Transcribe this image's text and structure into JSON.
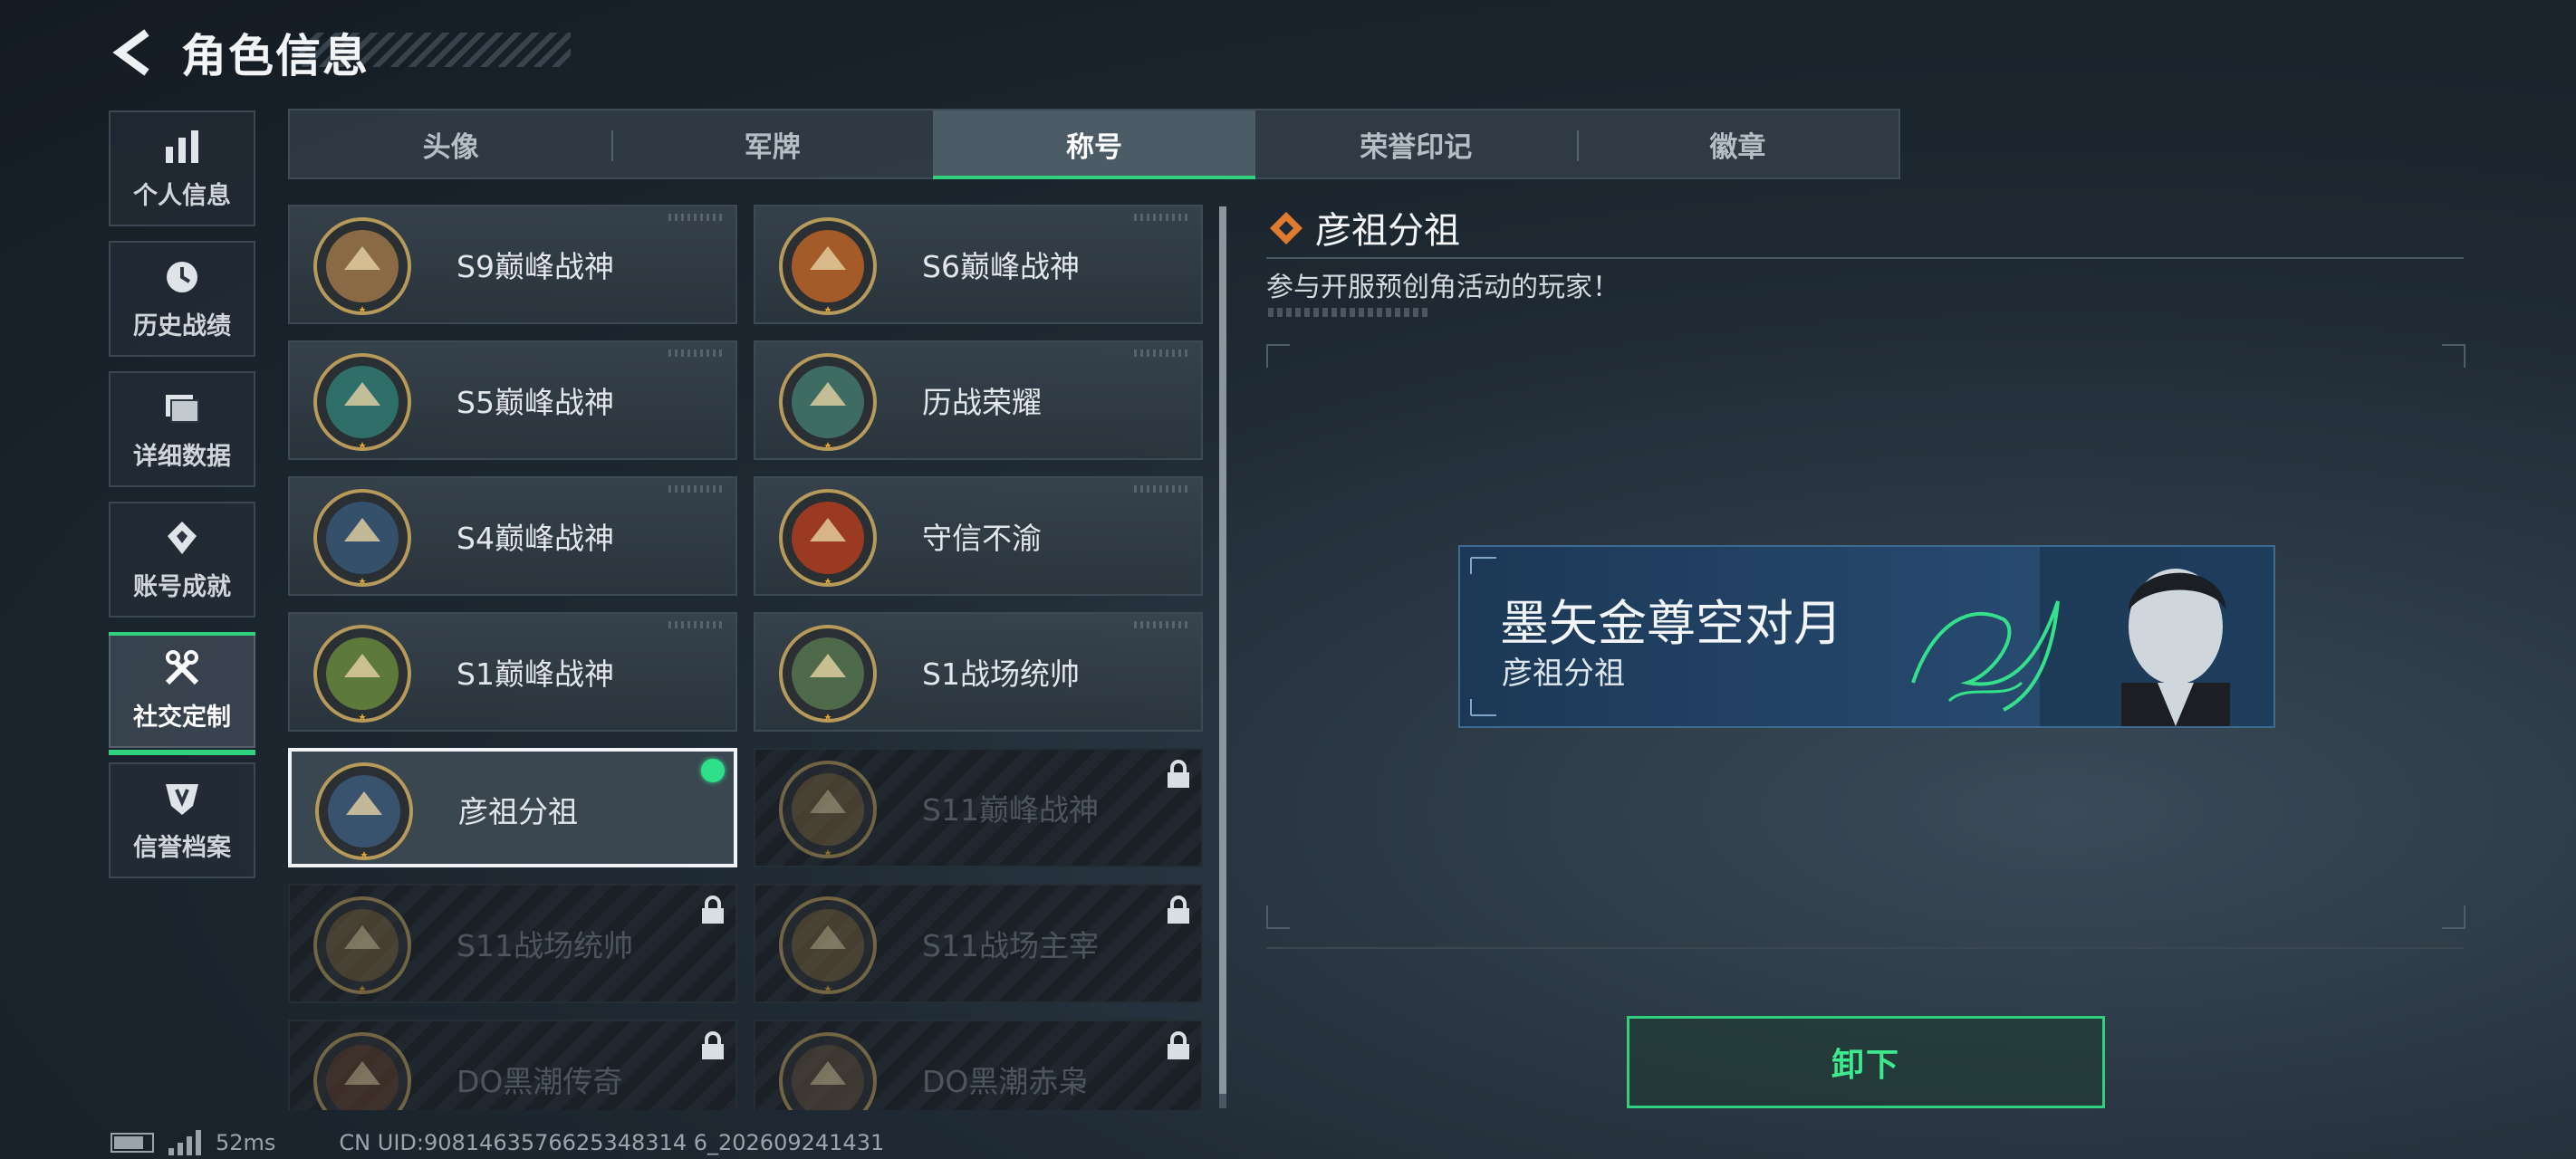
{
  "header": {
    "title": "角色信息"
  },
  "sidebar": {
    "items": [
      {
        "label": "个人信息",
        "icon": "bar-chart-icon"
      },
      {
        "label": "历史战绩",
        "icon": "history-clock-icon"
      },
      {
        "label": "详细数据",
        "icon": "folder-icon"
      },
      {
        "label": "账号成就",
        "icon": "achievement-icon"
      },
      {
        "label": "社交定制",
        "icon": "tools-icon",
        "active": true
      },
      {
        "label": "信誉档案",
        "icon": "credit-shield-icon"
      }
    ]
  },
  "tabs": [
    {
      "label": "头像"
    },
    {
      "label": "军牌"
    },
    {
      "label": "称号",
      "active": true
    },
    {
      "label": "荣誉印记"
    },
    {
      "label": "徽章"
    }
  ],
  "titles": [
    {
      "name": "S9巅峰战神",
      "emblem": "fortress-emblem-icon",
      "locked": false
    },
    {
      "name": "S6巅峰战神",
      "emblem": "t-shield-emblem-icon",
      "locked": false
    },
    {
      "name": "S5巅峰战神",
      "emblem": "diver-skull-emblem-icon",
      "locked": false
    },
    {
      "name": "历战荣耀",
      "emblem": "trophy-emblem-icon",
      "locked": false
    },
    {
      "name": "S4巅峰战神",
      "emblem": "helmet-nvg-emblem-icon",
      "locked": false
    },
    {
      "name": "守信不渝",
      "emblem": "scales-emblem-icon",
      "locked": false
    },
    {
      "name": "S1巅峰战神",
      "emblem": "crocodile-emblem-icon",
      "locked": false
    },
    {
      "name": "S1战场统帅",
      "emblem": "tank-emblem-icon",
      "locked": false
    },
    {
      "name": "彦祖分祖",
      "emblem": "portrait-emblem-icon",
      "locked": false,
      "selected": true
    },
    {
      "name": "S11巅峰战神",
      "emblem": "vehicle-emblem-icon",
      "locked": true
    },
    {
      "name": "S11战场统帅",
      "emblem": "apc-emblem-icon",
      "locked": true
    },
    {
      "name": "S11战场主宰",
      "emblem": "arch-emblem-icon",
      "locked": true
    },
    {
      "name": "DO黑潮传奇",
      "emblem": "hooded-emblem-icon",
      "locked": true
    },
    {
      "name": "DO黑潮赤枭",
      "emblem": "skull-emblem-icon",
      "locked": true
    }
  ],
  "detail": {
    "title": "彦祖分祖",
    "description": "参与开服预创角活动的玩家！",
    "banner": {
      "title": "墨矢金尊空对月",
      "subtitle": "彦祖分祖"
    },
    "action_label": "卸下"
  },
  "footer": {
    "ping": "52ms",
    "uid": "CN UID:9081463576625348314 6_202609241431"
  },
  "colors": {
    "accent": "#2fd17e",
    "panel": "#2c3640",
    "background": "#1b242c"
  }
}
